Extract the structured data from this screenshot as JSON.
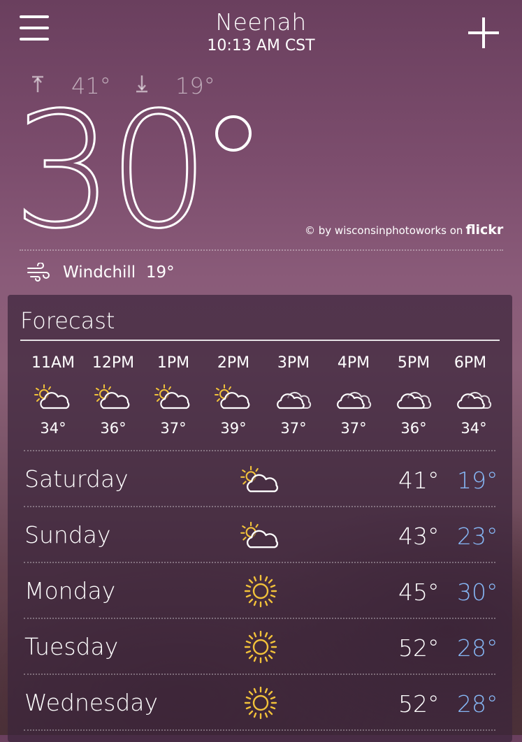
{
  "header": {
    "city": "Neenah",
    "time": "10:13 AM CST"
  },
  "current": {
    "high": "41°",
    "low": "19°",
    "temperature": "30",
    "windchill_label": "Windchill",
    "windchill_value": "19°"
  },
  "credit": {
    "prefix": "© by wisconsinphotoworks on",
    "brand": "flickr"
  },
  "forecast": {
    "title": "Forecast",
    "hourly": [
      {
        "time": "11AM",
        "icon": "partly-cloudy-icon",
        "temp": "34°"
      },
      {
        "time": "12PM",
        "icon": "partly-cloudy-icon",
        "temp": "36°"
      },
      {
        "time": "1PM",
        "icon": "partly-cloudy-icon",
        "temp": "37°"
      },
      {
        "time": "2PM",
        "icon": "partly-cloudy-icon",
        "temp": "39°"
      },
      {
        "time": "3PM",
        "icon": "cloudy-icon",
        "temp": "37°"
      },
      {
        "time": "4PM",
        "icon": "cloudy-icon",
        "temp": "37°"
      },
      {
        "time": "5PM",
        "icon": "cloudy-icon",
        "temp": "36°"
      },
      {
        "time": "6PM",
        "icon": "cloudy-icon",
        "temp": "34°"
      }
    ],
    "daily": [
      {
        "day": "Saturday",
        "icon": "partly-cloudy-icon",
        "high": "41°",
        "low": "19°"
      },
      {
        "day": "Sunday",
        "icon": "partly-cloudy-icon",
        "high": "43°",
        "low": "23°"
      },
      {
        "day": "Monday",
        "icon": "sunny-icon",
        "high": "45°",
        "low": "30°"
      },
      {
        "day": "Tuesday",
        "icon": "sunny-icon",
        "high": "52°",
        "low": "28°"
      },
      {
        "day": "Wednesday",
        "icon": "sunny-icon",
        "high": "52°",
        "low": "28°"
      }
    ]
  },
  "colors": {
    "low_temp": "#86b7f5",
    "sun": "#f2c23a"
  }
}
